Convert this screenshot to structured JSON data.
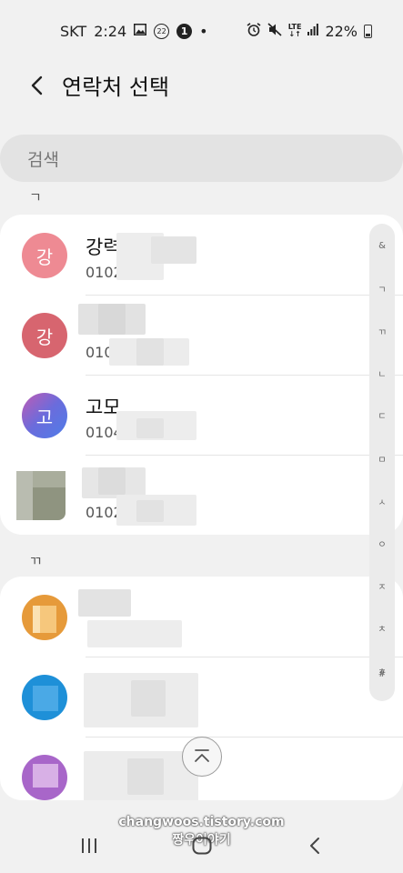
{
  "status_bar": {
    "carrier": "SKT",
    "time": "2:24",
    "badge_22": "22",
    "badge_1": "1",
    "dot": "•",
    "lte_top": "LTE",
    "lte_bottom": "↓↑",
    "battery": "22%"
  },
  "header": {
    "title": "연락처 선택"
  },
  "search": {
    "placeholder": "검색"
  },
  "sections": [
    {
      "label": "ㄱ",
      "contacts": [
        {
          "initial": "강",
          "name": "강력1팀",
          "phone": "0102",
          "avatar_color": "#ee8a93"
        },
        {
          "initial": "강",
          "name": "",
          "phone": "010",
          "avatar_color": "#d7656f"
        },
        {
          "initial": "고",
          "name": "고모",
          "phone": "0104",
          "avatar_color": "#6a6cdc"
        },
        {
          "initial": "",
          "name": "",
          "phone": "0102",
          "avatar_color": "#8f9480"
        }
      ]
    },
    {
      "label": "ㄲ",
      "contacts": [
        {
          "avatar_color": "#e69a3a"
        },
        {
          "avatar_color": "#1e90d8"
        },
        {
          "avatar_color": "#a866c9"
        }
      ]
    }
  ],
  "index_bar": [
    "&",
    "ㄱ",
    "ㄲ",
    "ㄴ",
    "ㄷ",
    "ㅁ",
    "ㅅ",
    "ㅇ",
    "ㅈ",
    "ㅊ",
    "ㅎ",
    "#"
  ],
  "watermark": {
    "line1": "changwoos.tistory.com",
    "line2": "짱우이야기"
  }
}
